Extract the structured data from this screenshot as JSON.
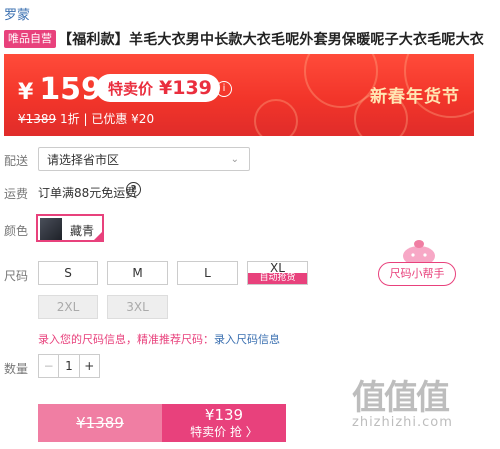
{
  "brand": "罗蒙",
  "product": {
    "tag": "唯品自营",
    "title": "【福利款】羊毛大衣男中长款大衣毛呢外套男保暖呢子大衣毛呢大衣"
  },
  "banner": {
    "currency": "¥",
    "price": "159",
    "promo_label": "特卖价",
    "promo_price": "¥139",
    "info_icon": "i",
    "original_price": "¥1389",
    "discount": "1折",
    "saved": "已优惠 ¥20",
    "festival": "新春年货节",
    "colors": {
      "top": "#ff4b3a",
      "bottom": "#e02c2a"
    }
  },
  "delivery": {
    "label": "配送",
    "placeholder": "请选择省市区"
  },
  "shipping": {
    "label": "运费",
    "text": "订单满88元免运费",
    "icon": "question-icon"
  },
  "color": {
    "label": "颜色",
    "options": [
      {
        "name": "藏青",
        "selected": true
      }
    ]
  },
  "size": {
    "label": "尺码",
    "options": [
      {
        "name": "S",
        "available": true
      },
      {
        "name": "M",
        "available": true
      },
      {
        "name": "L",
        "available": true
      },
      {
        "name": "XL",
        "available": true,
        "tag": "自动抢货"
      },
      {
        "name": "2XL",
        "available": false
      },
      {
        "name": "3XL",
        "available": false
      }
    ],
    "helper_button": "尺码小帮手",
    "tip": "录入您的尺码信息，精准推荐尺码：",
    "tip_link": "录入尺码信息"
  },
  "quantity": {
    "label": "数量",
    "value": "1",
    "minus": "−",
    "plus": "+"
  },
  "buy": {
    "original": "¥1389",
    "price": "¥139",
    "label": "特卖价 抢 〉"
  },
  "watermark": {
    "big": "值值值",
    "small": "zhizhizhi.com"
  },
  "accent": "#e8417c"
}
